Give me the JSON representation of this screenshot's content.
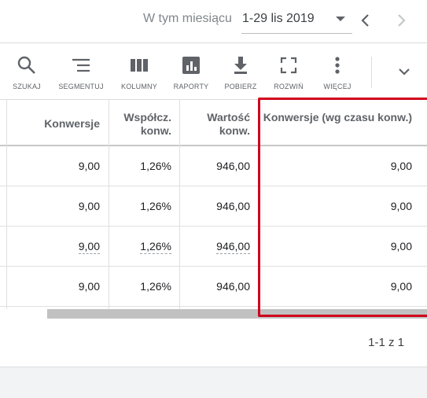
{
  "date_bar": {
    "period_label": "W tym miesiącu",
    "range": "1-29 lis 2019"
  },
  "toolbar": {
    "tools": [
      {
        "label": "SZUKAJ",
        "icon": "search-icon"
      },
      {
        "label": "SEGMENTUJ",
        "icon": "segment-icon"
      },
      {
        "label": "KOLUMNY",
        "icon": "columns-icon"
      },
      {
        "label": "RAPORTY",
        "icon": "reports-icon"
      },
      {
        "label": "POBIERZ",
        "icon": "download-icon"
      },
      {
        "label": "ROZWIŃ",
        "icon": "expand-icon"
      },
      {
        "label": "WIĘCEJ",
        "icon": "more-icon"
      }
    ]
  },
  "table": {
    "headers": {
      "conversions": "Konwersje",
      "conv_rate": "Współcz. konw.",
      "conv_value": "Wartość konw.",
      "conv_by_time": "Konwersje (wg czasu konw.)"
    },
    "rows": [
      {
        "conversions": "9,00",
        "conv_rate": "1,26%",
        "conv_value": "946,00",
        "conv_by_time": "9,00"
      },
      {
        "conversions": "9,00",
        "conv_rate": "1,26%",
        "conv_value": "946,00",
        "conv_by_time": "9,00"
      },
      {
        "conversions": "9,00",
        "conv_rate": "1,26%",
        "conv_value": "946,00",
        "conv_by_time": "9,00"
      },
      {
        "conversions": "9,00",
        "conv_rate": "1,26%",
        "conv_value": "946,00",
        "conv_by_time": "9,00"
      }
    ]
  },
  "pagination": {
    "text": "1-1 z 1"
  },
  "colors": {
    "highlight": "#d0021b",
    "icon": "#5f6368"
  }
}
